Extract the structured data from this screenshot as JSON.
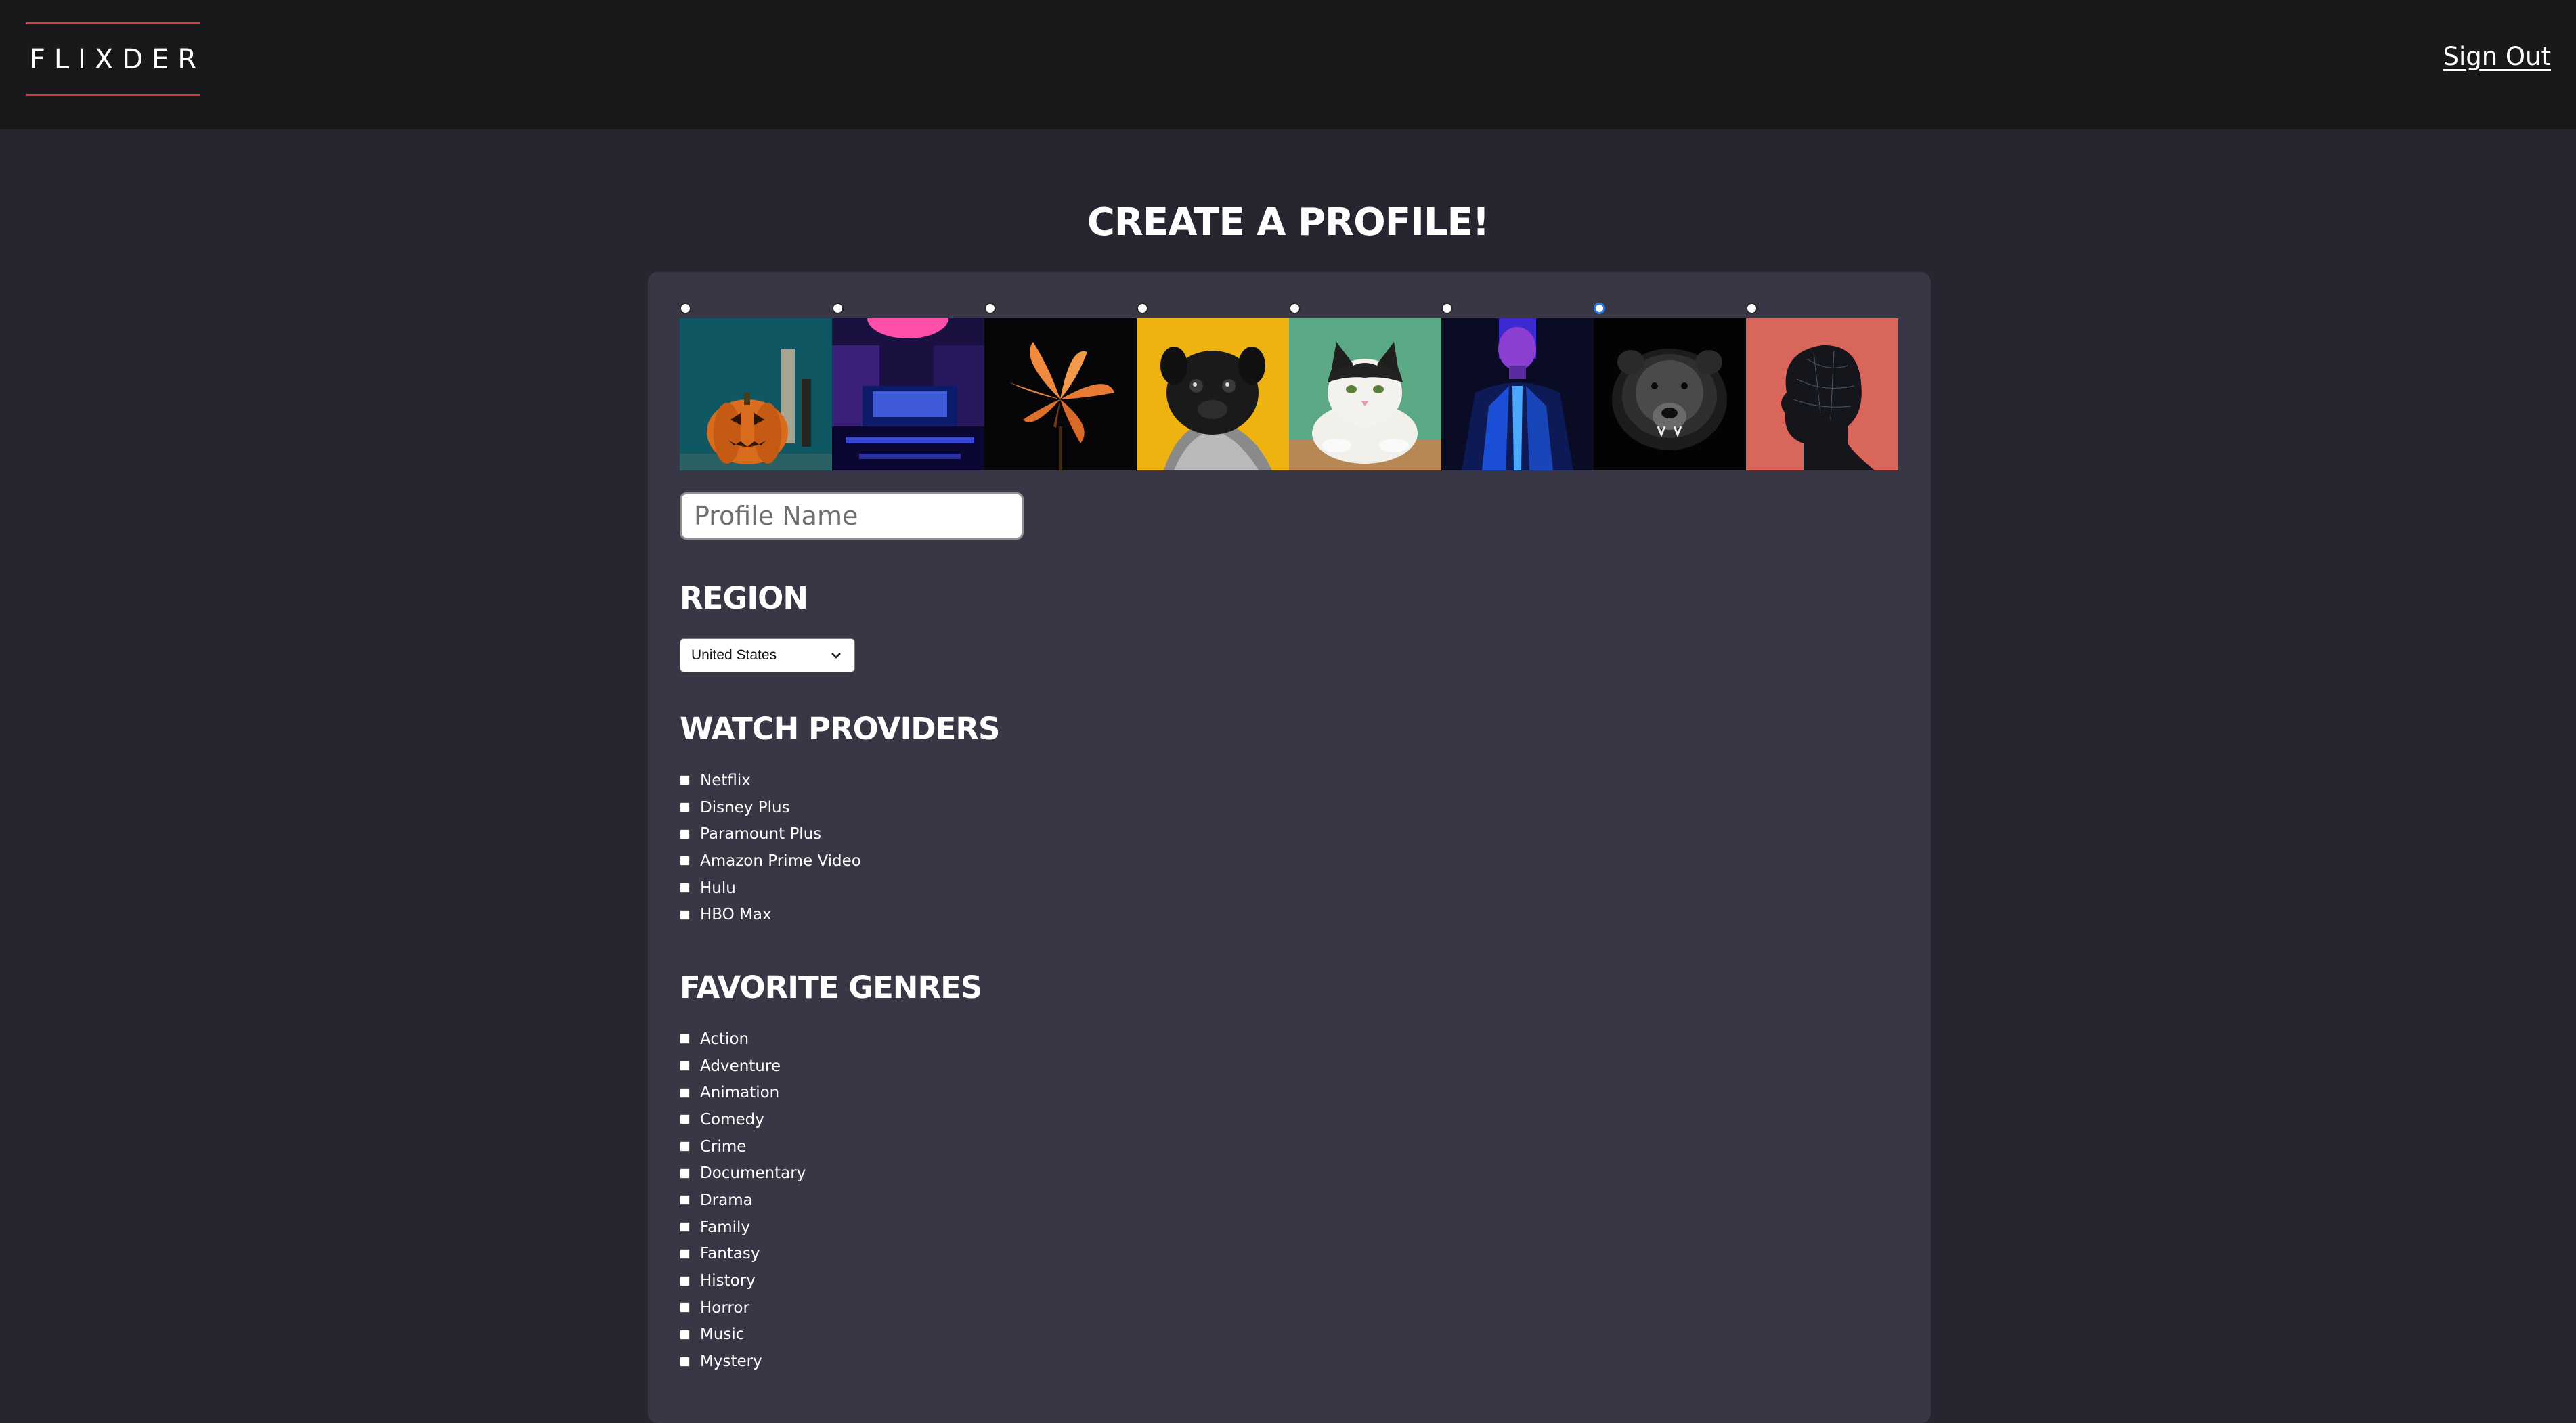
{
  "header": {
    "logo": "FLIXDER",
    "sign_out": "Sign Out"
  },
  "page_title": "CREATE A PROFILE!",
  "avatars": [
    {
      "name": "pumpkin-avatar",
      "selected": false
    },
    {
      "name": "neon-room-avatar",
      "selected": false
    },
    {
      "name": "lily-flower-avatar",
      "selected": false
    },
    {
      "name": "pug-avatar",
      "selected": false
    },
    {
      "name": "cat-avatar",
      "selected": false
    },
    {
      "name": "neon-person-avatar",
      "selected": false
    },
    {
      "name": "bear-avatar",
      "selected": true
    },
    {
      "name": "head-silhouette-avatar",
      "selected": false
    }
  ],
  "profile_name": {
    "value": "",
    "placeholder": "Profile Name"
  },
  "region": {
    "heading": "REGION",
    "selected": "United States"
  },
  "watch_providers": {
    "heading": "WATCH PROVIDERS",
    "items": [
      "Netflix",
      "Disney Plus",
      "Paramount Plus",
      "Amazon Prime Video",
      "Hulu",
      "HBO Max"
    ]
  },
  "favorite_genres": {
    "heading": "FAVORITE GENRES",
    "items": [
      "Action",
      "Adventure",
      "Animation",
      "Comedy",
      "Crime",
      "Documentary",
      "Drama",
      "Family",
      "Fantasy",
      "History",
      "Horror",
      "Music",
      "Mystery"
    ]
  },
  "colors": {
    "page_bg": "#272530",
    "header_bg": "#19191b",
    "card_bg": "#393645",
    "logo_accent": "#e0383e",
    "radio_selected": "#2a7ae2"
  }
}
